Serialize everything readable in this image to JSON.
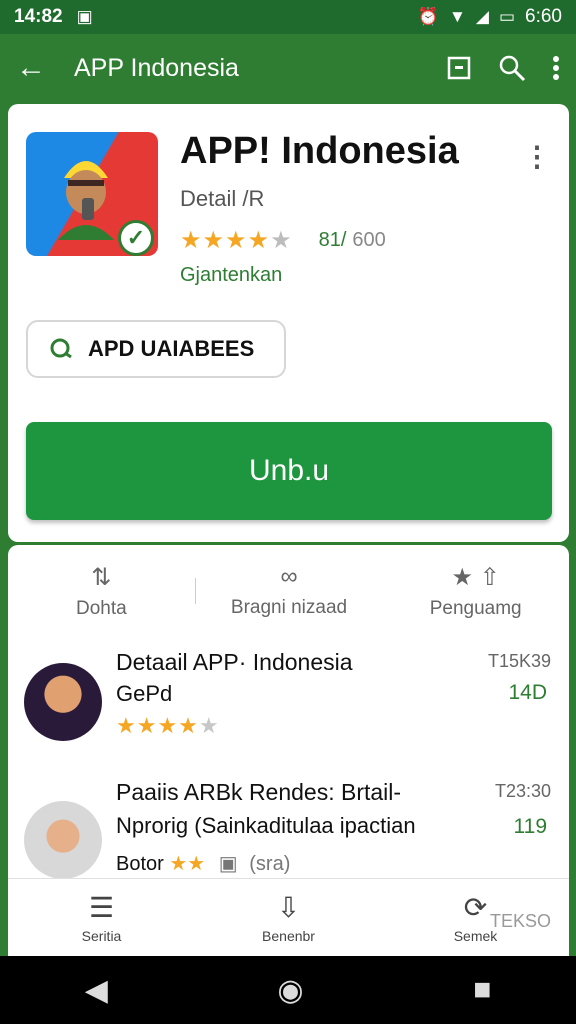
{
  "status_bar": {
    "time": "14:82",
    "right_time": "6:60"
  },
  "app_bar": {
    "title": "APP Indonesia",
    "icons": [
      "back-arrow-icon",
      "bookmark-icon",
      "search-icon",
      "more-vert-icon"
    ]
  },
  "app": {
    "name": "APP! Indonesia",
    "subtitle": "Detail /R",
    "rating": "81/",
    "rating_count": "600",
    "tag": "Gjantenkan",
    "chip_label": "APD UAIABEES",
    "primary_button": "Unb.u"
  },
  "tabs": [
    {
      "label": "Dohta",
      "icon": "arrows-icon"
    },
    {
      "label": "Bragni nizaad",
      "icon": "infinity-icon"
    },
    {
      "label": "Penguamg",
      "icon": "star-share-icon"
    }
  ],
  "list": [
    {
      "title": "Detaail APP· Indonesia",
      "sub": "GePd",
      "meta_top": "T15K39",
      "meta_bottom": "14D",
      "stars": 4
    },
    {
      "title": "Paaiis ARBk Rendes: Brtail-",
      "sub": "Nprorig (Sainkaditulaa ipactian",
      "sub2": "Botor",
      "sub2_extra": "(sra)",
      "meta_top": "T23:30",
      "meta_bottom": "119",
      "stars": 2
    }
  ],
  "bottom_nav": [
    {
      "label": "Seritia",
      "icon": "news-icon"
    },
    {
      "label": "Benenbr",
      "icon": "download-icon"
    },
    {
      "label": "Semek",
      "icon": "refresh-icon"
    }
  ],
  "bottom_extra": "TEKSO",
  "colors": {
    "primary": "#2e7d32",
    "button": "#1e9640",
    "star": "#f5a623"
  }
}
